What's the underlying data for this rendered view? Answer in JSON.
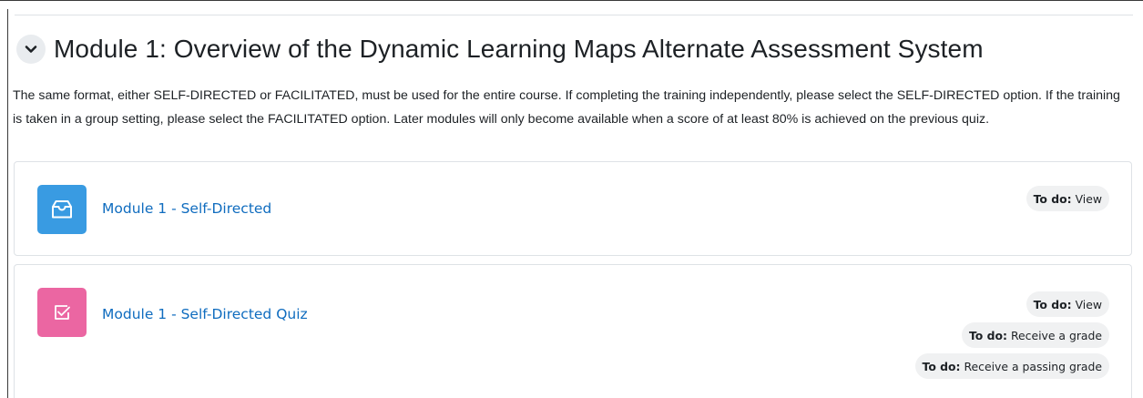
{
  "section": {
    "title": "Module 1: Overview of the Dynamic Learning Maps Alternate Assessment System",
    "summary": "The same format, either SELF-DIRECTED or FACILITATED, must be used for the entire course. If completing the training independently, please select the SELF-DIRECTED option. If the training is taken in a group setting, please select the FACILITATED option. Later modules will only become available when a score of at least 80% is achieved on the previous quiz.",
    "collapse_icon": "chevron-down-icon"
  },
  "activities": [
    {
      "name": "Module 1 - Self-Directed",
      "icon": "content-box-icon",
      "icon_color": "#399be2",
      "completion": [
        {
          "label": "To do:",
          "value": "View"
        }
      ]
    },
    {
      "name": "Module 1 - Self-Directed Quiz",
      "icon": "quiz-checkbox-icon",
      "icon_color": "#eb66a2",
      "completion": [
        {
          "label": "To do:",
          "value": "View"
        },
        {
          "label": "To do:",
          "value": "Receive a grade"
        },
        {
          "label": "To do:",
          "value": "Receive a passing grade"
        }
      ]
    }
  ],
  "colors": {
    "link": "#0f6cbf",
    "text": "#1d2125",
    "badge_bg": "#f0f1f2",
    "border": "#dee2e6"
  }
}
